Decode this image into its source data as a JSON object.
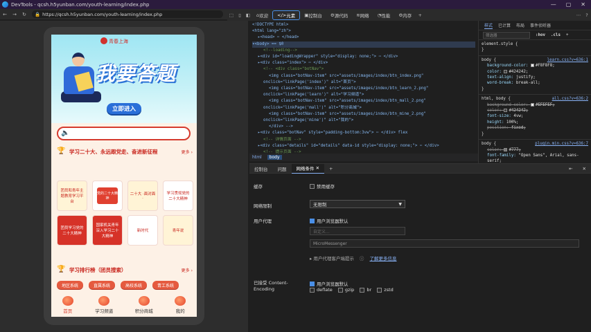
{
  "window": {
    "title": "DevTools - qcsh.h5yunban.com/youth-learning/index.php",
    "buttons": [
      "—",
      "▢",
      "✕"
    ]
  },
  "browser": {
    "url": "https://qcsh.h5yunban.com/youth-learning/index.php"
  },
  "devtools_tabs": [
    {
      "label": "欢迎",
      "active": false
    },
    {
      "label": "元素",
      "active": true
    },
    {
      "label": "控制台",
      "active": false
    },
    {
      "label": "源代码",
      "active": false
    },
    {
      "label": "网络",
      "active": false
    },
    {
      "label": "性能",
      "active": false
    },
    {
      "label": "内存",
      "active": false
    }
  ],
  "mobile_page": {
    "brand": "青春上海",
    "hero_title": "我要答题",
    "cta": "立即进入",
    "section1": {
      "title": "学习二十大、永远跟党走、奋进新征程",
      "more": "更多",
      "tiles": [
        "团员和青年主题教育学习平台",
        "党的二十大精神",
        "二十大 ·面对面·",
        "学习贯彻党的二十大精神",
        "团员学习党的二十大精神",
        "国家机关青年深入学习二十大精神",
        "新时代",
        "青年说"
      ]
    },
    "section2": {
      "title": "学习排行榜（团员搜索）",
      "more": "更多",
      "pills": [
        "地区系统",
        "直属系统",
        "高校系统",
        "青工系统"
      ]
    },
    "tabbar": [
      {
        "label": "首页",
        "active": true
      },
      {
        "label": "学习频道",
        "active": false
      },
      {
        "label": "积分商城",
        "active": false
      },
      {
        "label": "我的",
        "active": false
      }
    ]
  },
  "elements_panel": {
    "lines": [
      {
        "indent": 0,
        "html": "<!DOCTYPE html>"
      },
      {
        "indent": 0,
        "html": "<html lang=\"zh\">"
      },
      {
        "indent": 1,
        "html": "▸<head> ⋯ </head>"
      },
      {
        "indent": 0,
        "html": "▾<body> == $0",
        "selected": true
      },
      {
        "indent": 2,
        "html": "<!--loading-->"
      },
      {
        "indent": 1,
        "html": "▸<div id=\"loadingWrapper\" style=\"display: none;\"> ⋯ </div>"
      },
      {
        "indent": 1,
        "html": "▸<div class=\"index\"> ⋯ </div>"
      },
      {
        "indent": 2,
        "html": "<!-- <div class=\"botNav\">"
      },
      {
        "indent": 3,
        "html": "<img class=\"botNav-item\" src=\"assets/images/index/btn_index.png\""
      },
      {
        "indent": 2,
        "html": "onclick=\"linkPage('index')\" alt=\"首页\">"
      },
      {
        "indent": 3,
        "html": "<img class=\"botNav-item\" src=\"assets/images/index/btn_learn_2.png\""
      },
      {
        "indent": 2,
        "html": "onclick=\"linkPage('learn')\" alt=\"学习频道\">"
      },
      {
        "indent": 3,
        "html": "<img class=\"botNav-item\" src=\"assets/images/index/btn_mall_2.png\""
      },
      {
        "indent": 2,
        "html": "onclick=\"linkPage('mall')\" alt=\"积分商城\">"
      },
      {
        "indent": 3,
        "html": "<img class=\"botNav-item\" src=\"assets/images/index/btn_mine_2.png\""
      },
      {
        "indent": 2,
        "html": "onclick=\"linkPage('mine')\" alt=\"我的\">"
      },
      {
        "indent": 3,
        "html": "</div> -->"
      },
      {
        "indent": 1,
        "html": "▸<div class=\"botNav\" style=\"padding-bottom:3vw\"> ⋯ </div> flex"
      },
      {
        "indent": 2,
        "html": "<!-- 详情页面 -->"
      },
      {
        "indent": 1,
        "html": "▸<div class=\"details\" id=\"details\" data-id style=\"display: none;\"> ⋯ </div>"
      },
      {
        "indent": 2,
        "html": "<!-- 提示页面 -->"
      }
    ],
    "breadcrumb": [
      "html",
      "body"
    ]
  },
  "styles_panel": {
    "tabs": [
      "样式",
      "已计算",
      "布局",
      "事件侦听器"
    ],
    "filter_placeholder": "筛选器",
    "filter_buttons": [
      ":hov",
      ".cls",
      "+"
    ],
    "rules": [
      {
        "selector": "element.style {",
        "source": "",
        "props": [],
        "close": "}"
      },
      {
        "selector": "body {",
        "source": "learn.css?v=636:1",
        "props": [
          {
            "text": "background-color: ",
            "value": "#F8F8F8;",
            "swatch": "#F8F8F8"
          },
          {
            "text": "color: ",
            "value": "#424242;",
            "swatch": "#424242"
          },
          {
            "text": "text-align: ",
            "value": "justify;"
          },
          {
            "text": "word-break: ",
            "value": "break-all;"
          }
        ],
        "close": "}"
      },
      {
        "selector": "html, body {",
        "source": "all.css?v=636:2",
        "props": [
          {
            "text": "background-color: ",
            "value": "#EFEFEF;",
            "swatch": "#EFEFEF",
            "strike": true
          },
          {
            "text": "color: ",
            "value": "#424242;",
            "swatch": "#424242",
            "strike": true
          },
          {
            "text": "font-size: ",
            "value": "4vw;"
          },
          {
            "text": "height: ",
            "value": "100%;"
          },
          {
            "text": "position: ",
            "value": "fixed;",
            "strike": true
          }
        ],
        "close": "}"
      },
      {
        "selector": "body {",
        "source": "plugin.min.css?v=636:7",
        "props": [
          {
            "text": "color: ",
            "value": "#777;",
            "swatch": "#777777",
            "strike": true
          },
          {
            "text": "font-family: ",
            "value": "\"Open Sans\", Arial, sans-serif;"
          }
        ],
        "close": ""
      }
    ]
  },
  "drawer": {
    "tabs": [
      "控制台",
      "问题",
      "网络条件"
    ],
    "active_tab": "网络条件",
    "add": "+",
    "cache_label": "缓存",
    "cache_option": "禁用缓存",
    "throttle_label": "网络限制",
    "throttle_value": "无限制",
    "ua_label": "用户代理",
    "ua_option": "用户浏览器默认",
    "ua_select_placeholder": "自定义...",
    "ua_input_value": "MicroMessenger",
    "ua_hints": "▸ 用户代理客户端提示",
    "learn_more": "了解更多信息",
    "encoding_label": "已接受 Content-Encoding",
    "encoding_default": "用户浏览器默认",
    "encodings": [
      "deflate",
      "gzip",
      "br",
      "zstd"
    ]
  }
}
